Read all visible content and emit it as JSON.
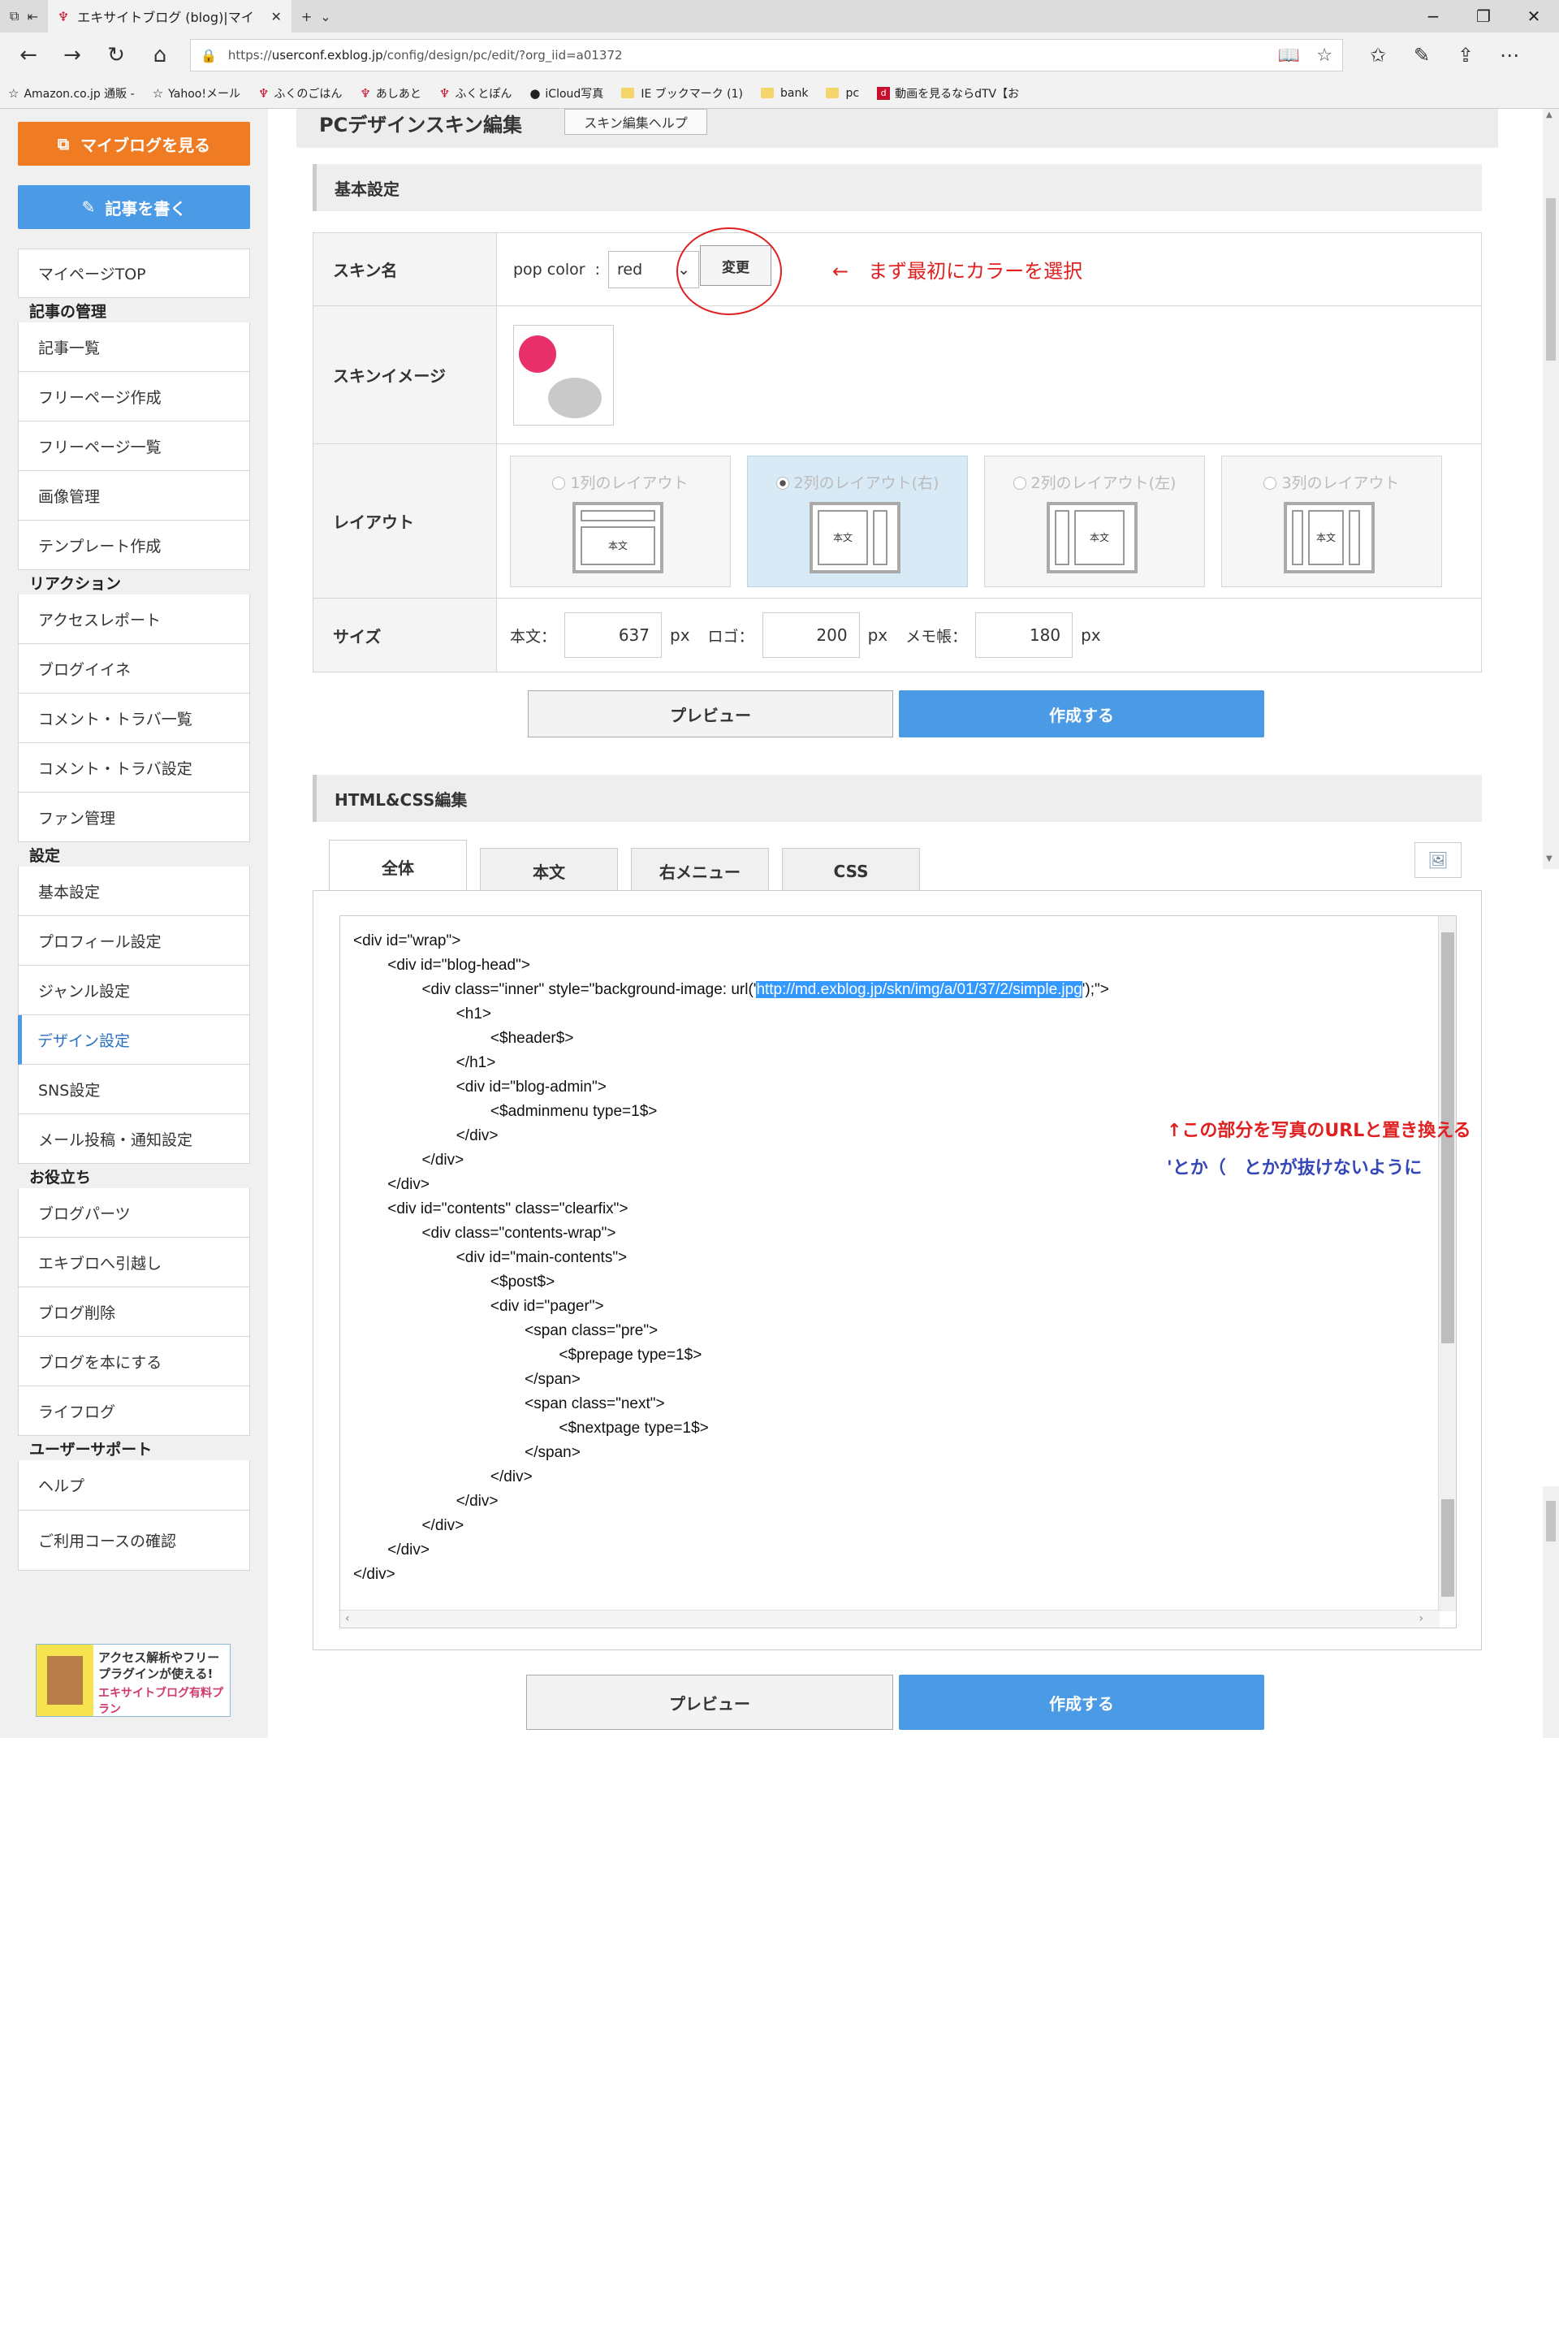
{
  "browser": {
    "tab_title": "エキサイトブログ (blog)|マイ",
    "new_tab": "+",
    "tab_menu": "⌄",
    "url_prefix": "https://",
    "url_domain": "userconf.exblog.jp",
    "url_path": "/config/design/pc/edit/?org_iid=a01372",
    "favorites": [
      {
        "icon": "star-icon",
        "label": "Amazon.co.jp 通販 -"
      },
      {
        "icon": "star-icon",
        "label": "Yahoo!メール"
      },
      {
        "icon": "logo-icon",
        "label": "ふくのごはん"
      },
      {
        "icon": "logo-icon",
        "label": "あしあと"
      },
      {
        "icon": "logo-icon",
        "label": "ふくとぽん"
      },
      {
        "icon": "apple-icon",
        "label": "iCloud写真"
      },
      {
        "icon": "folder-icon",
        "label": "IE ブックマーク (1)"
      },
      {
        "icon": "folder-icon",
        "label": "bank"
      },
      {
        "icon": "folder-icon",
        "label": "pc"
      },
      {
        "icon": "dtv-icon",
        "label": "動画を見るならdTV【お"
      }
    ]
  },
  "sidebar": {
    "my_blog_button": "マイブログを見る",
    "write_button": "記事を書く",
    "mypage": "マイページTOP",
    "sections": [
      {
        "heading": "記事の管理",
        "items": [
          "記事一覧",
          "フリーページ作成",
          "フリーページ一覧",
          "画像管理",
          "テンプレート作成"
        ]
      },
      {
        "heading": "リアクション",
        "items": [
          "アクセスレポート",
          "ブログイイネ",
          "コメント・トラバ一覧",
          "コメント・トラバ設定",
          "ファン管理"
        ]
      },
      {
        "heading": "設定",
        "items": [
          "基本設定",
          "プロフィール設定",
          "ジャンル設定",
          "デザイン設定",
          "SNS設定",
          "メール投稿・通知設定"
        ]
      },
      {
        "heading": "お役立ち",
        "items": [
          "ブログパーツ",
          "エキブロへ引越し",
          "ブログ削除",
          "ブログを本にする",
          "ライフログ"
        ]
      },
      {
        "heading": "ユーザーサポート",
        "items": [
          "ヘルプ",
          "ご利用コースの確認"
        ]
      }
    ],
    "active_item": "デザイン設定",
    "banner_line1": "アクセス解析やフリープラグインが使える!",
    "banner_line2": "エキサイトブログ有料プラン"
  },
  "main": {
    "title": "PCデザインスキン編集",
    "help_button": "スキン編集ヘルプ",
    "basic_heading": "基本設定",
    "skin_name_label": "スキン名",
    "skin_name_value": "pop color",
    "skin_colon": ":",
    "color_select": "red",
    "change_button": "変更",
    "annotation_select": "←　まず最初にカラーを選択",
    "skin_image_label": "スキンイメージ",
    "layout_label": "レイアウト",
    "layouts": [
      {
        "label": "1列のレイアウト",
        "selected": false,
        "content": "本文"
      },
      {
        "label": "2列のレイアウト(右)",
        "selected": true,
        "content": "本文"
      },
      {
        "label": "2列のレイアウト(左)",
        "selected": false,
        "content": "本文"
      },
      {
        "label": "3列のレイアウト",
        "selected": false,
        "content": "本文"
      }
    ],
    "size_label": "サイズ",
    "size_body_label": "本文：",
    "size_body": "637",
    "size_logo_label": "ロゴ：",
    "size_logo": "200",
    "size_memo_label": "メモ帳：",
    "size_memo": "180",
    "unit": "px",
    "preview_button": "プレビュー",
    "create_button": "作成する",
    "html_heading": "HTML&CSS編集",
    "tabs": [
      "全体",
      "本文",
      "右メニュー",
      "CSS"
    ],
    "active_tab": "全体",
    "code_lines": [
      "<div id=\"wrap\">",
      "        <div id=\"blog-head\">",
      "                <div class=\"inner\" style=\"background-image: url('",
      "                        <h1>",
      "                                <$header$>",
      "                        </h1>",
      "                        <div id=\"blog-admin\">",
      "                                <$adminmenu type=1$>",
      "                        </div>",
      "                </div>",
      "        </div>",
      "        <div id=\"contents\" class=\"clearfix\">",
      "                <div class=\"contents-wrap\">",
      "                        <div id=\"main-contents\">",
      "                                <$post$>",
      "                                <div id=\"pager\">",
      "                                        <span class=\"pre\">",
      "                                                <$prepage type=1$>",
      "                                        </span>",
      "                                        <span class=\"next\">",
      "                                                <$nextpage type=1$>",
      "                                        </span>",
      "                                </div>",
      "                        </div>",
      "                </div>",
      "        </div>",
      "</div>"
    ],
    "code_url": "http://md.exblog.jp/skn/img/a/01/37/2/simple.jpg",
    "code_url_tail": "');\">",
    "annotation_replace": "↑この部分を写真のURLと置き換える",
    "annotation_quotes": "'とか（　とかが抜けないように"
  }
}
